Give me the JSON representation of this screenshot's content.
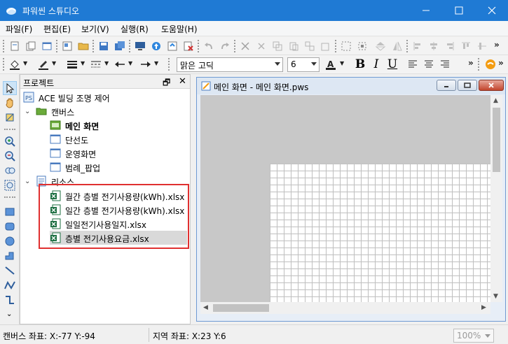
{
  "window": {
    "title": "파워씬 스튜디오",
    "colors": {
      "titlebar": "#1f7ad4",
      "highlight": "#e03030"
    }
  },
  "menu": {
    "items": [
      "파일(F)",
      "편집(E)",
      "보기(V)",
      "실행(R)",
      "도움말(H)"
    ]
  },
  "toolbar": {
    "font_name": "맑은 고딕",
    "font_size": "6",
    "bold": "B",
    "italic": "I",
    "underline": "U",
    "overflow": "»"
  },
  "project_pane": {
    "title": "프로젝트",
    "pin_glyph": "🗗",
    "close_glyph": "✕",
    "root": "ACE 빌딩 조명 제어",
    "canvas_group": "캔버스",
    "canvases": [
      "메인 화면",
      "단선도",
      "운영화면",
      "범례_팝업"
    ],
    "resource_group": "리소스",
    "resources": [
      "월간 층별 전기사용량(kWh).xlsx",
      "일간 층별 전기사용량(kWh).xlsx",
      "일일전기사용일지.xlsx",
      "층별 전기사용요금.xlsx"
    ]
  },
  "document": {
    "title": "메인 화면 - 메인 화면.pws"
  },
  "status": {
    "canvas_coords": "캔버스 좌표: X:-77 Y:-94",
    "region_coords": "지역 좌표: X:23 Y:6",
    "zoom": "100%"
  }
}
